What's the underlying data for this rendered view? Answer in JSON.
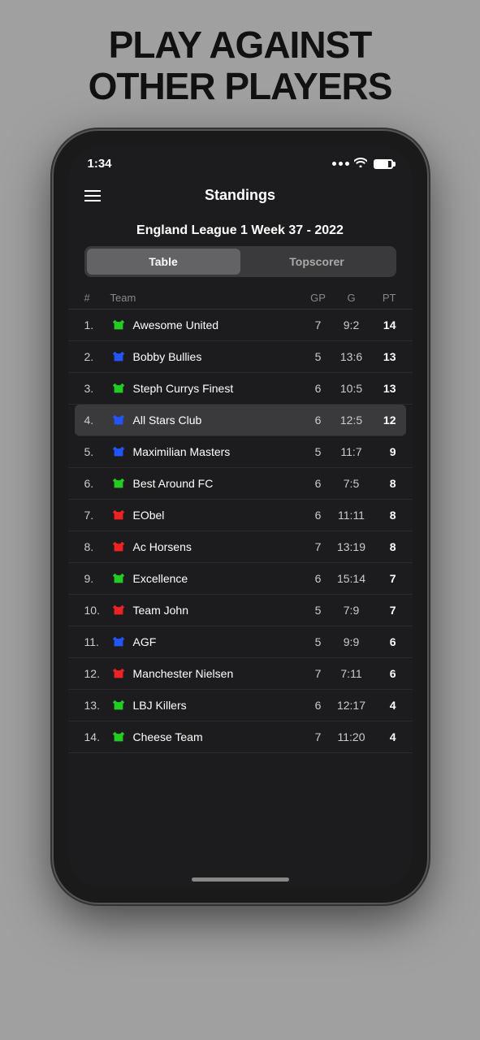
{
  "headline": {
    "line1": "PLAY AGAINST",
    "line2": "OTHER PLAYERS"
  },
  "status": {
    "time": "1:34",
    "battery_level": "80"
  },
  "header": {
    "title": "Standings",
    "menu_label": "Menu"
  },
  "league": {
    "title": "England League 1 Week 37 - 2022"
  },
  "tabs": [
    {
      "label": "Table",
      "active": true
    },
    {
      "label": "Topscorer",
      "active": false
    }
  ],
  "table_columns": {
    "rank": "#",
    "team": "Team",
    "gp": "GP",
    "g": "G",
    "pt": "PT"
  },
  "teams": [
    {
      "rank": "1.",
      "name": "Awesome United",
      "gp": "7",
      "g": "9:2",
      "pt": "14",
      "jersey_color": "green",
      "highlighted": false
    },
    {
      "rank": "2.",
      "name": "Bobby Bullies",
      "gp": "5",
      "g": "13:6",
      "pt": "13",
      "jersey_color": "blue",
      "highlighted": false
    },
    {
      "rank": "3.",
      "name": "Steph Currys Finest",
      "gp": "6",
      "g": "10:5",
      "pt": "13",
      "jersey_color": "green",
      "highlighted": false
    },
    {
      "rank": "4.",
      "name": "All Stars Club",
      "gp": "6",
      "g": "12:5",
      "pt": "12",
      "jersey_color": "blue",
      "highlighted": true
    },
    {
      "rank": "5.",
      "name": "Maximilian Masters",
      "gp": "5",
      "g": "11:7",
      "pt": "9",
      "jersey_color": "blue",
      "highlighted": false
    },
    {
      "rank": "6.",
      "name": "Best Around FC",
      "gp": "6",
      "g": "7:5",
      "pt": "8",
      "jersey_color": "green",
      "highlighted": false
    },
    {
      "rank": "7.",
      "name": "EObel",
      "gp": "6",
      "g": "11:11",
      "pt": "8",
      "jersey_color": "red",
      "highlighted": false
    },
    {
      "rank": "8.",
      "name": "Ac Horsens",
      "gp": "7",
      "g": "13:19",
      "pt": "8",
      "jersey_color": "red",
      "highlighted": false
    },
    {
      "rank": "9.",
      "name": "Excellence",
      "gp": "6",
      "g": "15:14",
      "pt": "7",
      "jersey_color": "green",
      "highlighted": false
    },
    {
      "rank": "10.",
      "name": "Team John",
      "gp": "5",
      "g": "7:9",
      "pt": "7",
      "jersey_color": "red",
      "highlighted": false
    },
    {
      "rank": "11.",
      "name": "AGF",
      "gp": "5",
      "g": "9:9",
      "pt": "6",
      "jersey_color": "blue",
      "highlighted": false
    },
    {
      "rank": "12.",
      "name": "Manchester Nielsen",
      "gp": "7",
      "g": "7:11",
      "pt": "6",
      "jersey_color": "red",
      "highlighted": false
    },
    {
      "rank": "13.",
      "name": "LBJ Killers",
      "gp": "6",
      "g": "12:17",
      "pt": "4",
      "jersey_color": "green",
      "highlighted": false
    },
    {
      "rank": "14.",
      "name": "Cheese Team",
      "gp": "7",
      "g": "11:20",
      "pt": "4",
      "jersey_color": "green",
      "highlighted": false
    }
  ]
}
